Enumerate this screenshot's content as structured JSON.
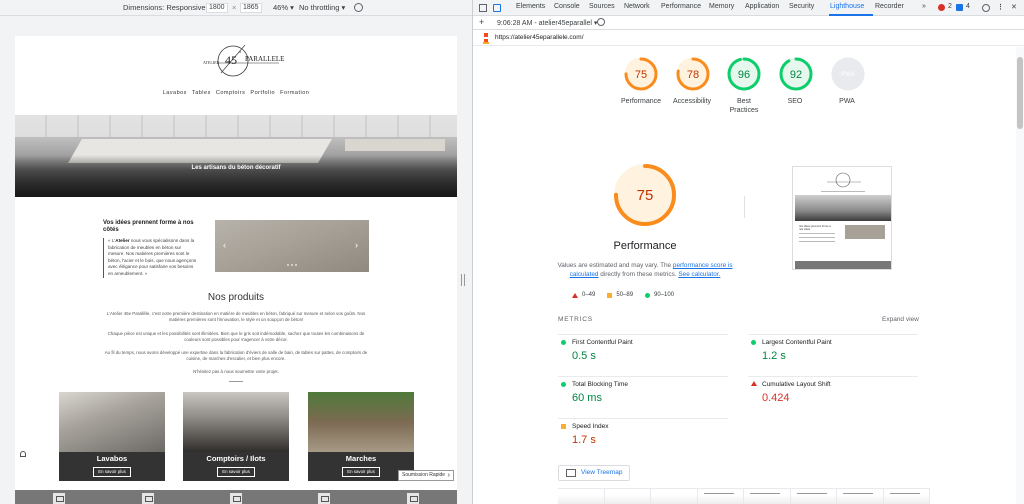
{
  "device_toolbar": {
    "dimensions_label": "Dimensions: Responsive",
    "width": "1800",
    "times": "×",
    "height": "1865",
    "zoom": "46%",
    "throttling": "No throttling"
  },
  "site": {
    "logo_small": "ATELIER",
    "logo_number": "45",
    "logo_degree": "°",
    "logo_word": "PARALLELE",
    "nav": [
      "Lavabos",
      "Tables",
      "Comptoirs",
      "Portfolio",
      "Formation"
    ],
    "hero_tagline": "Les artisans du béton décoratif",
    "intro_title": "Vos idées prennent forme à nos côtés",
    "intro_quote_prefix": "« L'",
    "intro_quote_brand": "Atelier",
    "intro_quote_text": " nous vous spécialisons dans la fabrication de meubles en béton sur mesure.  Nos matières premières sont le béton, l'acier et le bois, que nous agençons avec élégance pour satisfaire vos besoins en ameublement. »",
    "products_title": "Nos produits",
    "products_p1": "L'Atelier 45e Parallèle, c'est votre première destination en matière de meubles en béton, fabriqué sur mesure et selon vos goûts. Nos matières premières sont l'innovation, le style et un soupçon de béton!",
    "products_p2": "Chaque pièce est unique et les possibilités sont illimitées. Bien que le gris soit indémodable, sachez que toutes les combinaisons de couleurs sont possibles pour s'agencer à votre décor.",
    "products_p3": "Au fil du temps, nous avons développé une expertise dans la fabrication d'éviers de salle de bain, de tables sur pattes, de comptoirs de cuisine, de marches d'escalier, et bien plus encore.",
    "products_p4": "N'hésitez pas à nous soumettre votre projet.",
    "cards": [
      {
        "title": "Lavabos",
        "button": "En savoir plus"
      },
      {
        "title": "Comptoirs / Ilots",
        "button": "En savoir plus"
      },
      {
        "title": "Marches",
        "button": "En savoir plus"
      }
    ],
    "quick_submit": "Soumission Rapide"
  },
  "devtools": {
    "tabs": [
      "Elements",
      "Console",
      "Sources",
      "Network",
      "Performance",
      "Memory",
      "Application",
      "Security",
      "Lighthouse",
      "Recorder"
    ],
    "active_tab": "Lighthouse",
    "overflow": "»",
    "errors_count": "2",
    "messages_count": "4",
    "report_time": "9:06:28 AM - atelier45eparallel",
    "report_dropdown": "▾",
    "url": "https://atelier45eparallele.com/"
  },
  "scores": [
    {
      "name": "Performance",
      "value": 75,
      "color": "#fa8c1e",
      "track": "#fff3e0"
    },
    {
      "name": "Accessibility",
      "value": 78,
      "color": "#fa8c1e",
      "track": "#fff3e0"
    },
    {
      "name": "Best Practices",
      "value": 96,
      "color": "#0cce6b",
      "track": "#e6f8ee"
    },
    {
      "name": "SEO",
      "value": 92,
      "color": "#0cce6b",
      "track": "#e6f8ee"
    },
    {
      "name": "PWA",
      "value": "PWA",
      "color": "#9aa0a6",
      "track": "#e8eaed"
    }
  ],
  "performance": {
    "score": 75,
    "title": "Performance",
    "note_1": "Values are estimated and may vary. The ",
    "note_link_1": "performance score is calculated",
    "note_2": " directly from these metrics. ",
    "note_link_2": "See calculator.",
    "legend": [
      "0–49",
      "50–89",
      "90–100"
    ]
  },
  "metrics": {
    "header": "METRICS",
    "expand": "Expand view",
    "items": [
      {
        "name": "First Contentful Paint",
        "value": "0.5 s",
        "status": "good",
        "color": "#0cce6b"
      },
      {
        "name": "Largest Contentful Paint",
        "value": "1.2 s",
        "status": "good",
        "color": "#0cce6b"
      },
      {
        "name": "Total Blocking Time",
        "value": "60 ms",
        "status": "good",
        "color": "#0cce6b"
      },
      {
        "name": "Cumulative Layout Shift",
        "value": "0.424",
        "status": "poor",
        "color": "#d93025"
      },
      {
        "name": "Speed Index",
        "value": "1.7 s",
        "status": "average",
        "color": "#c33300"
      }
    ],
    "treemap": "View Treemap"
  },
  "final_screenshot": {
    "section_title": "Vos idées prennent forme à nos côtés"
  },
  "colors": {
    "accent": "#1a73e8",
    "good": "#0cce6b",
    "average": "#fa8c1e",
    "poor": "#d93025"
  }
}
